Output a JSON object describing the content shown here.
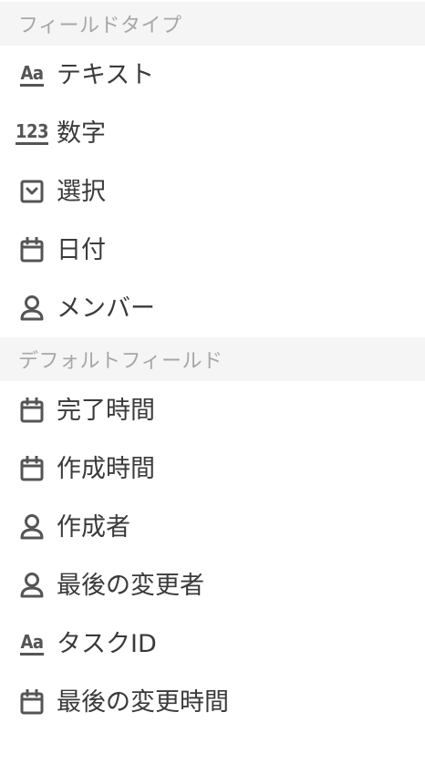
{
  "sections": [
    {
      "header": "フィールドタイプ",
      "items": [
        {
          "label": "テキスト",
          "icon": "text-aa-icon",
          "glyph": "Aa"
        },
        {
          "label": "数字",
          "icon": "number-icon",
          "glyph": "123"
        },
        {
          "label": "選択",
          "icon": "select-dropdown-icon"
        },
        {
          "label": "日付",
          "icon": "calendar-icon"
        },
        {
          "label": "メンバー",
          "icon": "person-icon"
        }
      ]
    },
    {
      "header": "デフォルトフィールド",
      "items": [
        {
          "label": "完了時間",
          "icon": "calendar-icon"
        },
        {
          "label": "作成時間",
          "icon": "calendar-icon"
        },
        {
          "label": "作成者",
          "icon": "person-icon"
        },
        {
          "label": "最後の変更者",
          "icon": "person-icon"
        },
        {
          "label": "タスクID",
          "icon": "text-aa-icon",
          "glyph": "Aa"
        },
        {
          "label": "最後の変更時間",
          "icon": "calendar-icon"
        }
      ]
    }
  ],
  "colors": {
    "header_bg": "#f5f5f5",
    "header_text": "#a7a7a7",
    "item_text": "#3a3a3a",
    "icon": "#555555"
  }
}
